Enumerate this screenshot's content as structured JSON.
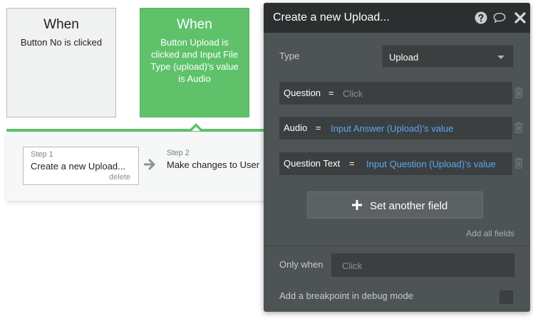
{
  "events": [
    {
      "title": "When",
      "description": "Button No is clicked"
    },
    {
      "title": "When",
      "description": "Button Upload is clicked and Input File Type (upload)'s value is Audio"
    }
  ],
  "steps": {
    "step1": {
      "label": "Step 1",
      "title": "Create a new Upload...",
      "delete_label": "delete"
    },
    "step2": {
      "label": "Step 2",
      "title": "Make changes to User"
    }
  },
  "popup": {
    "title": "Create a new Upload...",
    "header_icons": [
      "help-icon",
      "comment-icon",
      "close-icon"
    ],
    "type_label": "Type",
    "type_value": "Upload",
    "fields": [
      {
        "name": "Question",
        "equals": "=",
        "value": "Click",
        "is_placeholder": true
      },
      {
        "name": "Audio",
        "equals": "=",
        "value": "Input Answer (Upload)'s value",
        "is_placeholder": false
      },
      {
        "name": "Question Text",
        "equals": "=",
        "value": "Input Question (Upload)'s value",
        "is_placeholder": false
      }
    ],
    "set_field_label": "Set another field",
    "add_all_label": "Add all fields",
    "only_when_label": "Only when",
    "only_when_placeholder": "Click",
    "breakpoint_label": "Add a breakpoint in debug mode",
    "breakpoint_checked": false
  },
  "colors": {
    "event_active": "#5fc26b",
    "popup_bg": "#4e5455",
    "header_bg": "#2b2f30",
    "expression": "#5aa8f0"
  }
}
